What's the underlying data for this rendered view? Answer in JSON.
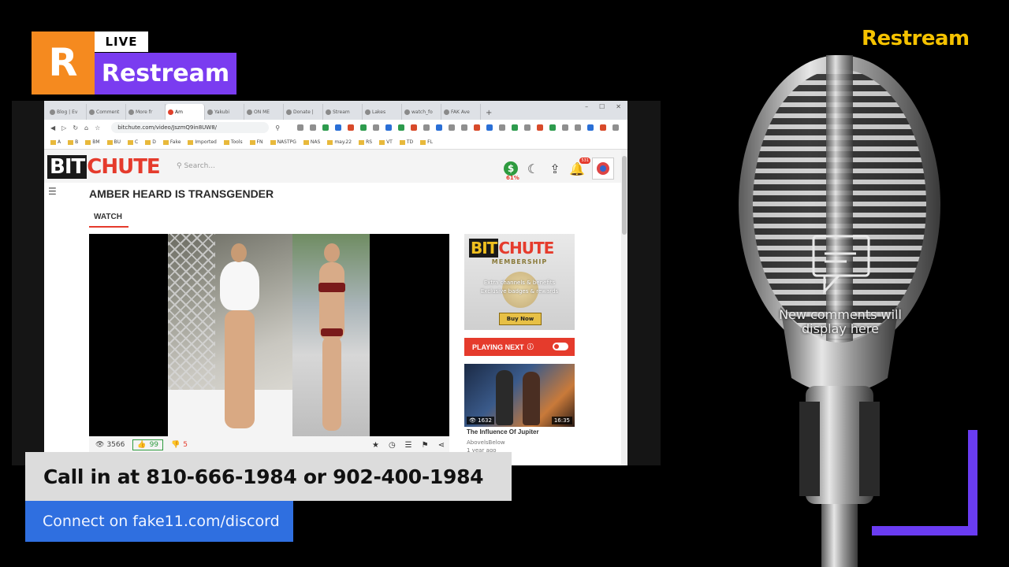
{
  "overlay": {
    "logo_letter": "R",
    "live_label": "LIVE",
    "brand_name": "Restream",
    "corner_brand": "Restream",
    "call_in_text": "Call in at 810-666-1984 or 902-400-1984",
    "discord_text": "Connect on fake11.com/discord",
    "comments_placeholder": "New comments will display here",
    "colors": {
      "orange": "#f58a1f",
      "purple": "#7a3cf0",
      "yellow": "#f5c200",
      "blue": "#2f6fe0"
    }
  },
  "browser": {
    "tabs": [
      "Blog | Ev",
      "Comment",
      "More fr",
      "Am",
      "Yakubi",
      "ON ME",
      "Donate |",
      "Stream",
      "Lakes",
      "watch_fo",
      "FAK Ave"
    ],
    "active_tab": "Am",
    "url": "bitchute.com/video/JszmQ9in8UW8/",
    "bookmarks": [
      "A",
      "B",
      "BM",
      "BU",
      "C",
      "D",
      "Fake",
      "Imported",
      "Tools",
      "FN",
      "NASTPG",
      "NAS",
      "may.22",
      "RS",
      "VT",
      "TD",
      "FL"
    ]
  },
  "bitchute": {
    "logo_bit": "BIT",
    "logo_chute": "CHUTE",
    "search_placeholder": "Search...",
    "notif_count": "531",
    "percent": "61%",
    "video_title": "AMBER HEARD IS TRANSGENDER",
    "watch_tab": "WATCH",
    "views": "3566",
    "likes": "99",
    "dislikes": "5",
    "ad": {
      "logo_bit": "BIT",
      "logo_chute": "CHUTE",
      "membership": "MEMBERSHIP",
      "line1": "Extra channels & benefits",
      "line2": "Exclusive badges & rewards",
      "buy": "Buy Now"
    },
    "playing_next": "PLAYING NEXT",
    "next_video": {
      "views": "1632",
      "duration": "16:35",
      "title": "The Influence Of Jupiter",
      "channel": "AbovelsBelow",
      "age": "1 year ago"
    }
  }
}
